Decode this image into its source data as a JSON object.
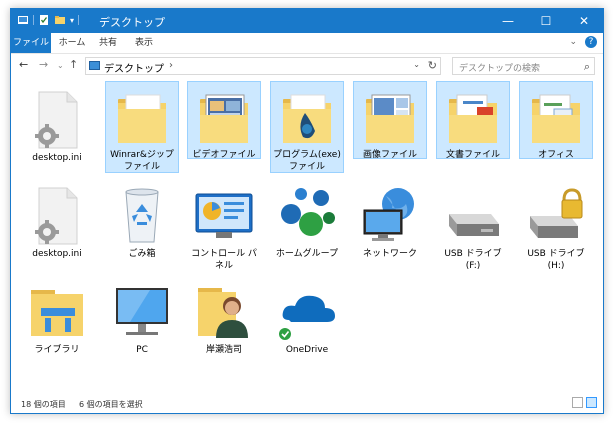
{
  "window": {
    "title": "デスクトップ"
  },
  "ribbon": {
    "tabs": [
      "ファイル",
      "ホーム",
      "共有",
      "表示"
    ]
  },
  "address": {
    "location": "デスクトップ",
    "separator": "›"
  },
  "search": {
    "placeholder": "デスクトップの検索"
  },
  "items": [
    {
      "label": "desktop.ini"
    },
    {
      "label": "Winrar&ジップ\nファイル"
    },
    {
      "label": "ビデオファイル"
    },
    {
      "label": "プログラム(exe)\nファイル"
    },
    {
      "label": "画像ファイル"
    },
    {
      "label": "文書ファイル"
    },
    {
      "label": "オフィス"
    },
    {
      "label": "desktop.ini"
    },
    {
      "label": "ごみ箱"
    },
    {
      "label": "コントロール パ\nネル"
    },
    {
      "label": "ホームグループ"
    },
    {
      "label": "ネットワーク"
    },
    {
      "label": "USB ドライブ\n(F:)"
    },
    {
      "label": "USB ドライブ\n(H:)"
    },
    {
      "label": "ライブラリ"
    },
    {
      "label": "PC"
    },
    {
      "label": "岸瀬浩司"
    },
    {
      "label": "OneDrive"
    }
  ],
  "status": {
    "count": "18 個の項目",
    "selected": "6 個の項目を選択"
  }
}
